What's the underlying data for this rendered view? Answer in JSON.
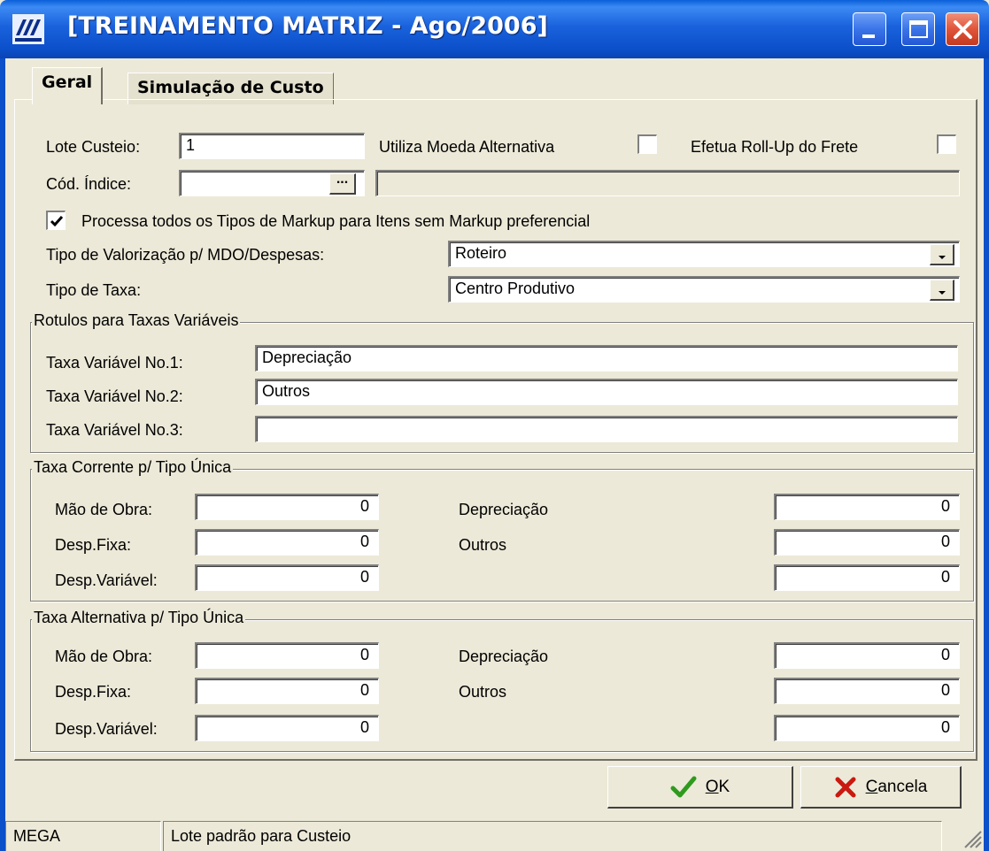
{
  "window": {
    "title": "[TREINAMENTO MATRIZ - Ago/2006]"
  },
  "tabs": [
    {
      "label": "Geral",
      "active": true
    },
    {
      "label": "Simulação de Custo",
      "active": false
    }
  ],
  "form": {
    "lote_custeio_label": "Lote Custeio:",
    "lote_custeio_value": "1",
    "utiliza_moeda_label": "Utiliza Moeda Alternativa",
    "utiliza_moeda_checked": false,
    "efetua_rollup_label": "Efetua Roll-Up do Frete",
    "efetua_rollup_checked": false,
    "cod_indice_label": "Cód. Índice:",
    "cod_indice_value": "",
    "cod_indice_button": "...",
    "cod_indice_description": "",
    "processa_markup_label": "Processa todos os Tipos de Markup para Itens sem Markup preferencial",
    "processa_markup_checked": true,
    "tipo_valorizacao_label": "Tipo de Valorização p/ MDO/Despesas:",
    "tipo_valorizacao_value": "Roteiro",
    "tipo_taxa_label": "Tipo de Taxa:",
    "tipo_taxa_value": "Centro Produtivo"
  },
  "rotulos_group": {
    "title": "Rotulos para Taxas Variáveis",
    "rows": [
      {
        "label": "Taxa Variável No.1:",
        "value": "Depreciação"
      },
      {
        "label": "Taxa Variável No.2:",
        "value": "Outros"
      },
      {
        "label": "Taxa Variável No.3:",
        "value": ""
      }
    ]
  },
  "taxa_corrente_group": {
    "title": "Taxa Corrente p/ Tipo Única",
    "left": [
      {
        "label": "Mão de Obra:",
        "value": "0"
      },
      {
        "label": "Desp.Fixa:",
        "value": "0"
      },
      {
        "label": "Desp.Variável:",
        "value": "0"
      }
    ],
    "right": [
      {
        "label": "Depreciação",
        "value": "0"
      },
      {
        "label": "Outros",
        "value": "0"
      },
      {
        "label": "",
        "value": "0"
      }
    ]
  },
  "taxa_alternativa_group": {
    "title": "Taxa Alternativa p/ Tipo Única",
    "left": [
      {
        "label": "Mão de Obra:",
        "value": "0"
      },
      {
        "label": "Desp.Fixa:",
        "value": "0"
      },
      {
        "label": "Desp.Variável:",
        "value": "0"
      }
    ],
    "right": [
      {
        "label": "Depreciação",
        "value": "0"
      },
      {
        "label": "Outros",
        "value": "0"
      },
      {
        "label": "",
        "value": "0"
      }
    ]
  },
  "buttons": {
    "ok_label_underlined": "O",
    "ok_label_rest": "K",
    "cancel_label_underlined": "C",
    "cancel_label_rest": "ancela"
  },
  "statusbar": {
    "company": "MEGA",
    "message": "Lote padrão para Custeio"
  },
  "icons": {
    "app": "mega-logo-icon",
    "minimize": "minimize-icon",
    "maximize": "maximize-icon",
    "close": "close-icon",
    "ok": "checkmark-icon",
    "cancel": "x-icon",
    "dropdown": "chevron-down-icon",
    "resize": "resize-grip-icon"
  },
  "colors": {
    "titlebar": "#0B4FC9",
    "dialog_bg": "#ECE9D8",
    "close_button": "#E0543A",
    "ok_check": "#2E9A1E",
    "cancel_x": "#C81A10"
  }
}
